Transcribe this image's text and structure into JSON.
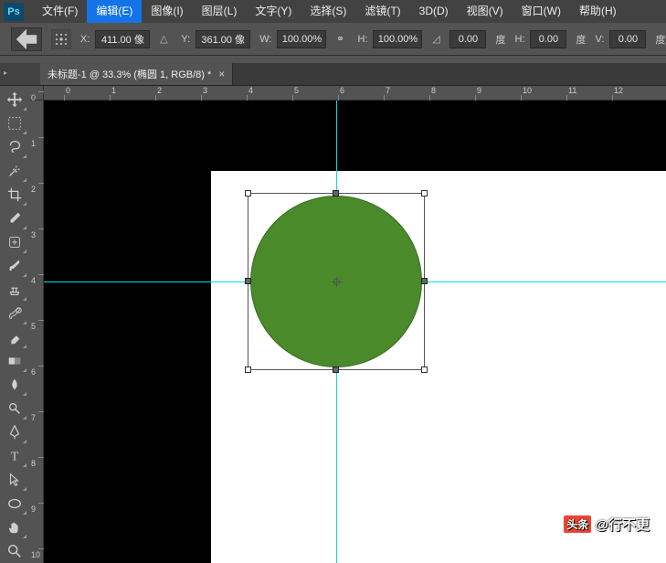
{
  "menu": {
    "items": [
      {
        "label": "文件(F)"
      },
      {
        "label": "编辑(E)"
      },
      {
        "label": "图像(I)"
      },
      {
        "label": "图层(L)"
      },
      {
        "label": "文字(Y)"
      },
      {
        "label": "选择(S)"
      },
      {
        "label": "滤镜(T)"
      },
      {
        "label": "3D(D)"
      },
      {
        "label": "视图(V)"
      },
      {
        "label": "窗口(W)"
      },
      {
        "label": "帮助(H)"
      }
    ],
    "selected_index": 1
  },
  "logo_text": "Ps",
  "options_bar": {
    "x_label": "X:",
    "x_value": "411.00 像",
    "y_label": "Y:",
    "y_value": "361.00 像",
    "w_label": "W:",
    "w_value": "100.00%",
    "h_label": "H:",
    "h_value": "100.00%",
    "angle1_value": "0.00",
    "angle1_unit": "度",
    "skew_h_label": "H:",
    "skew_h_value": "0.00",
    "skew_h_unit": "度",
    "skew_v_label": "V:",
    "skew_v_value": "0.00",
    "skew_v_unit": "度"
  },
  "tab": {
    "title": "未标题-1 @ 33.3% (椭圆 1, RGB/8) *"
  },
  "ruler": {
    "h_labels": [
      "0",
      "1",
      "2",
      "3",
      "4",
      "5",
      "6",
      "7",
      "8",
      "9",
      "10",
      "11",
      "12"
    ],
    "v_labels": [
      "0",
      "1",
      "2",
      "3",
      "4",
      "5",
      "6",
      "7",
      "8",
      "9",
      "10"
    ]
  },
  "tools": [
    {
      "n": "move-tool"
    },
    {
      "n": "marquee-tool"
    },
    {
      "n": "lasso-tool"
    },
    {
      "n": "magic-wand-tool"
    },
    {
      "n": "crop-tool"
    },
    {
      "n": "eyedropper-tool"
    },
    {
      "n": "healing-brush-tool"
    },
    {
      "n": "brush-tool"
    },
    {
      "n": "clone-stamp-tool"
    },
    {
      "n": "history-brush-tool"
    },
    {
      "n": "eraser-tool"
    },
    {
      "n": "gradient-tool"
    },
    {
      "n": "blur-tool"
    },
    {
      "n": "dodge-tool"
    },
    {
      "n": "pen-tool"
    },
    {
      "n": "text-tool"
    },
    {
      "n": "path-select-tool"
    },
    {
      "n": "shape-tool"
    },
    {
      "n": "hand-tool"
    },
    {
      "n": "zoom-tool"
    }
  ],
  "watermark": {
    "brand": "头条",
    "text": "@行不更"
  }
}
